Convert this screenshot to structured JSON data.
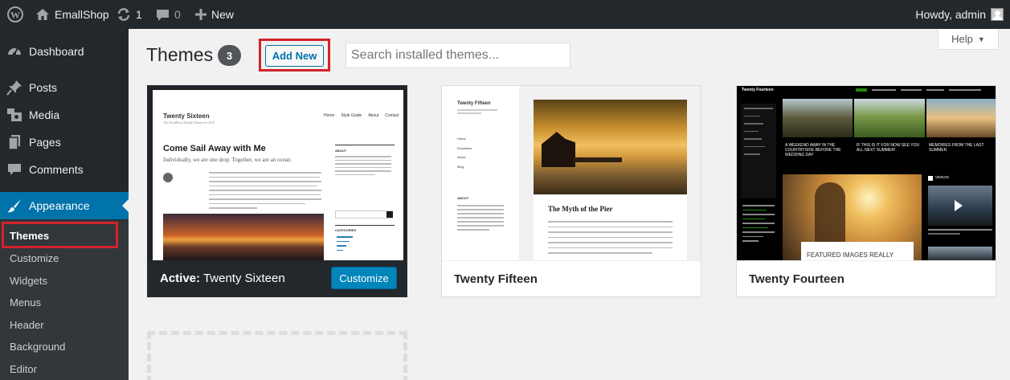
{
  "adminbar": {
    "site_name": "EmallShop",
    "updates_count": "1",
    "comments_count": "0",
    "new_label": "New",
    "greeting": "Howdy, admin"
  },
  "sidebar": {
    "items": [
      {
        "label": "Dashboard",
        "icon": "dashboard-icon"
      },
      {
        "label": "Posts",
        "icon": "pin-icon"
      },
      {
        "label": "Media",
        "icon": "media-icon"
      },
      {
        "label": "Pages",
        "icon": "pages-icon"
      },
      {
        "label": "Comments",
        "icon": "comment-icon"
      },
      {
        "label": "Appearance",
        "icon": "brush-icon"
      }
    ],
    "submenu": [
      "Themes",
      "Customize",
      "Widgets",
      "Menus",
      "Header",
      "Background",
      "Editor"
    ]
  },
  "page": {
    "title": "Themes",
    "count": "3",
    "add_new_label": "Add New",
    "search_placeholder": "Search installed themes...",
    "help_label": "Help"
  },
  "themes": [
    {
      "name": "Twenty Sixteen",
      "active_prefix": "Active:",
      "customize_label": "Customize",
      "preview": {
        "site_title": "Twenty Sixteen",
        "tagline": "The WordPress Default Theme for 2016",
        "nav": [
          "Home",
          "Style Guide",
          "About",
          "Contact"
        ],
        "post_title": "Come Sail Away with Me",
        "post_subtitle": "Individually, we are one drop. Together, we are an ocean.",
        "widget_about": "ABOUT",
        "widget_categories": "CATEGORIES"
      }
    },
    {
      "name": "Twenty Fifteen",
      "preview": {
        "site_title": "Twenty Fifteen",
        "nav": [
          "Home",
          "Dropdown",
          "About",
          "Blog"
        ],
        "widget_about": "ABOUT",
        "post_title": "The Myth of the Pier"
      }
    },
    {
      "name": "Twenty Fourteen",
      "preview": {
        "site_title": "Twenty Fourteen",
        "captions": [
          "A WEEKEND AWAY IN THE COUNTRYSIDE BEFORE THE WEDDING DAY",
          "IF THIS IS IT FOR NOW SEE YOU ALL NEXT SUMMER!",
          "MEMORIES FROM THE LAST SUMMER"
        ],
        "featured": "FEATURED IMAGES REALLY",
        "videos": "VIDEOS"
      }
    }
  ],
  "colors": {
    "admin_bg": "#23282d",
    "accent": "#0073aa",
    "highlight_border": "#d2232a",
    "primary_button": "#0085ba"
  }
}
